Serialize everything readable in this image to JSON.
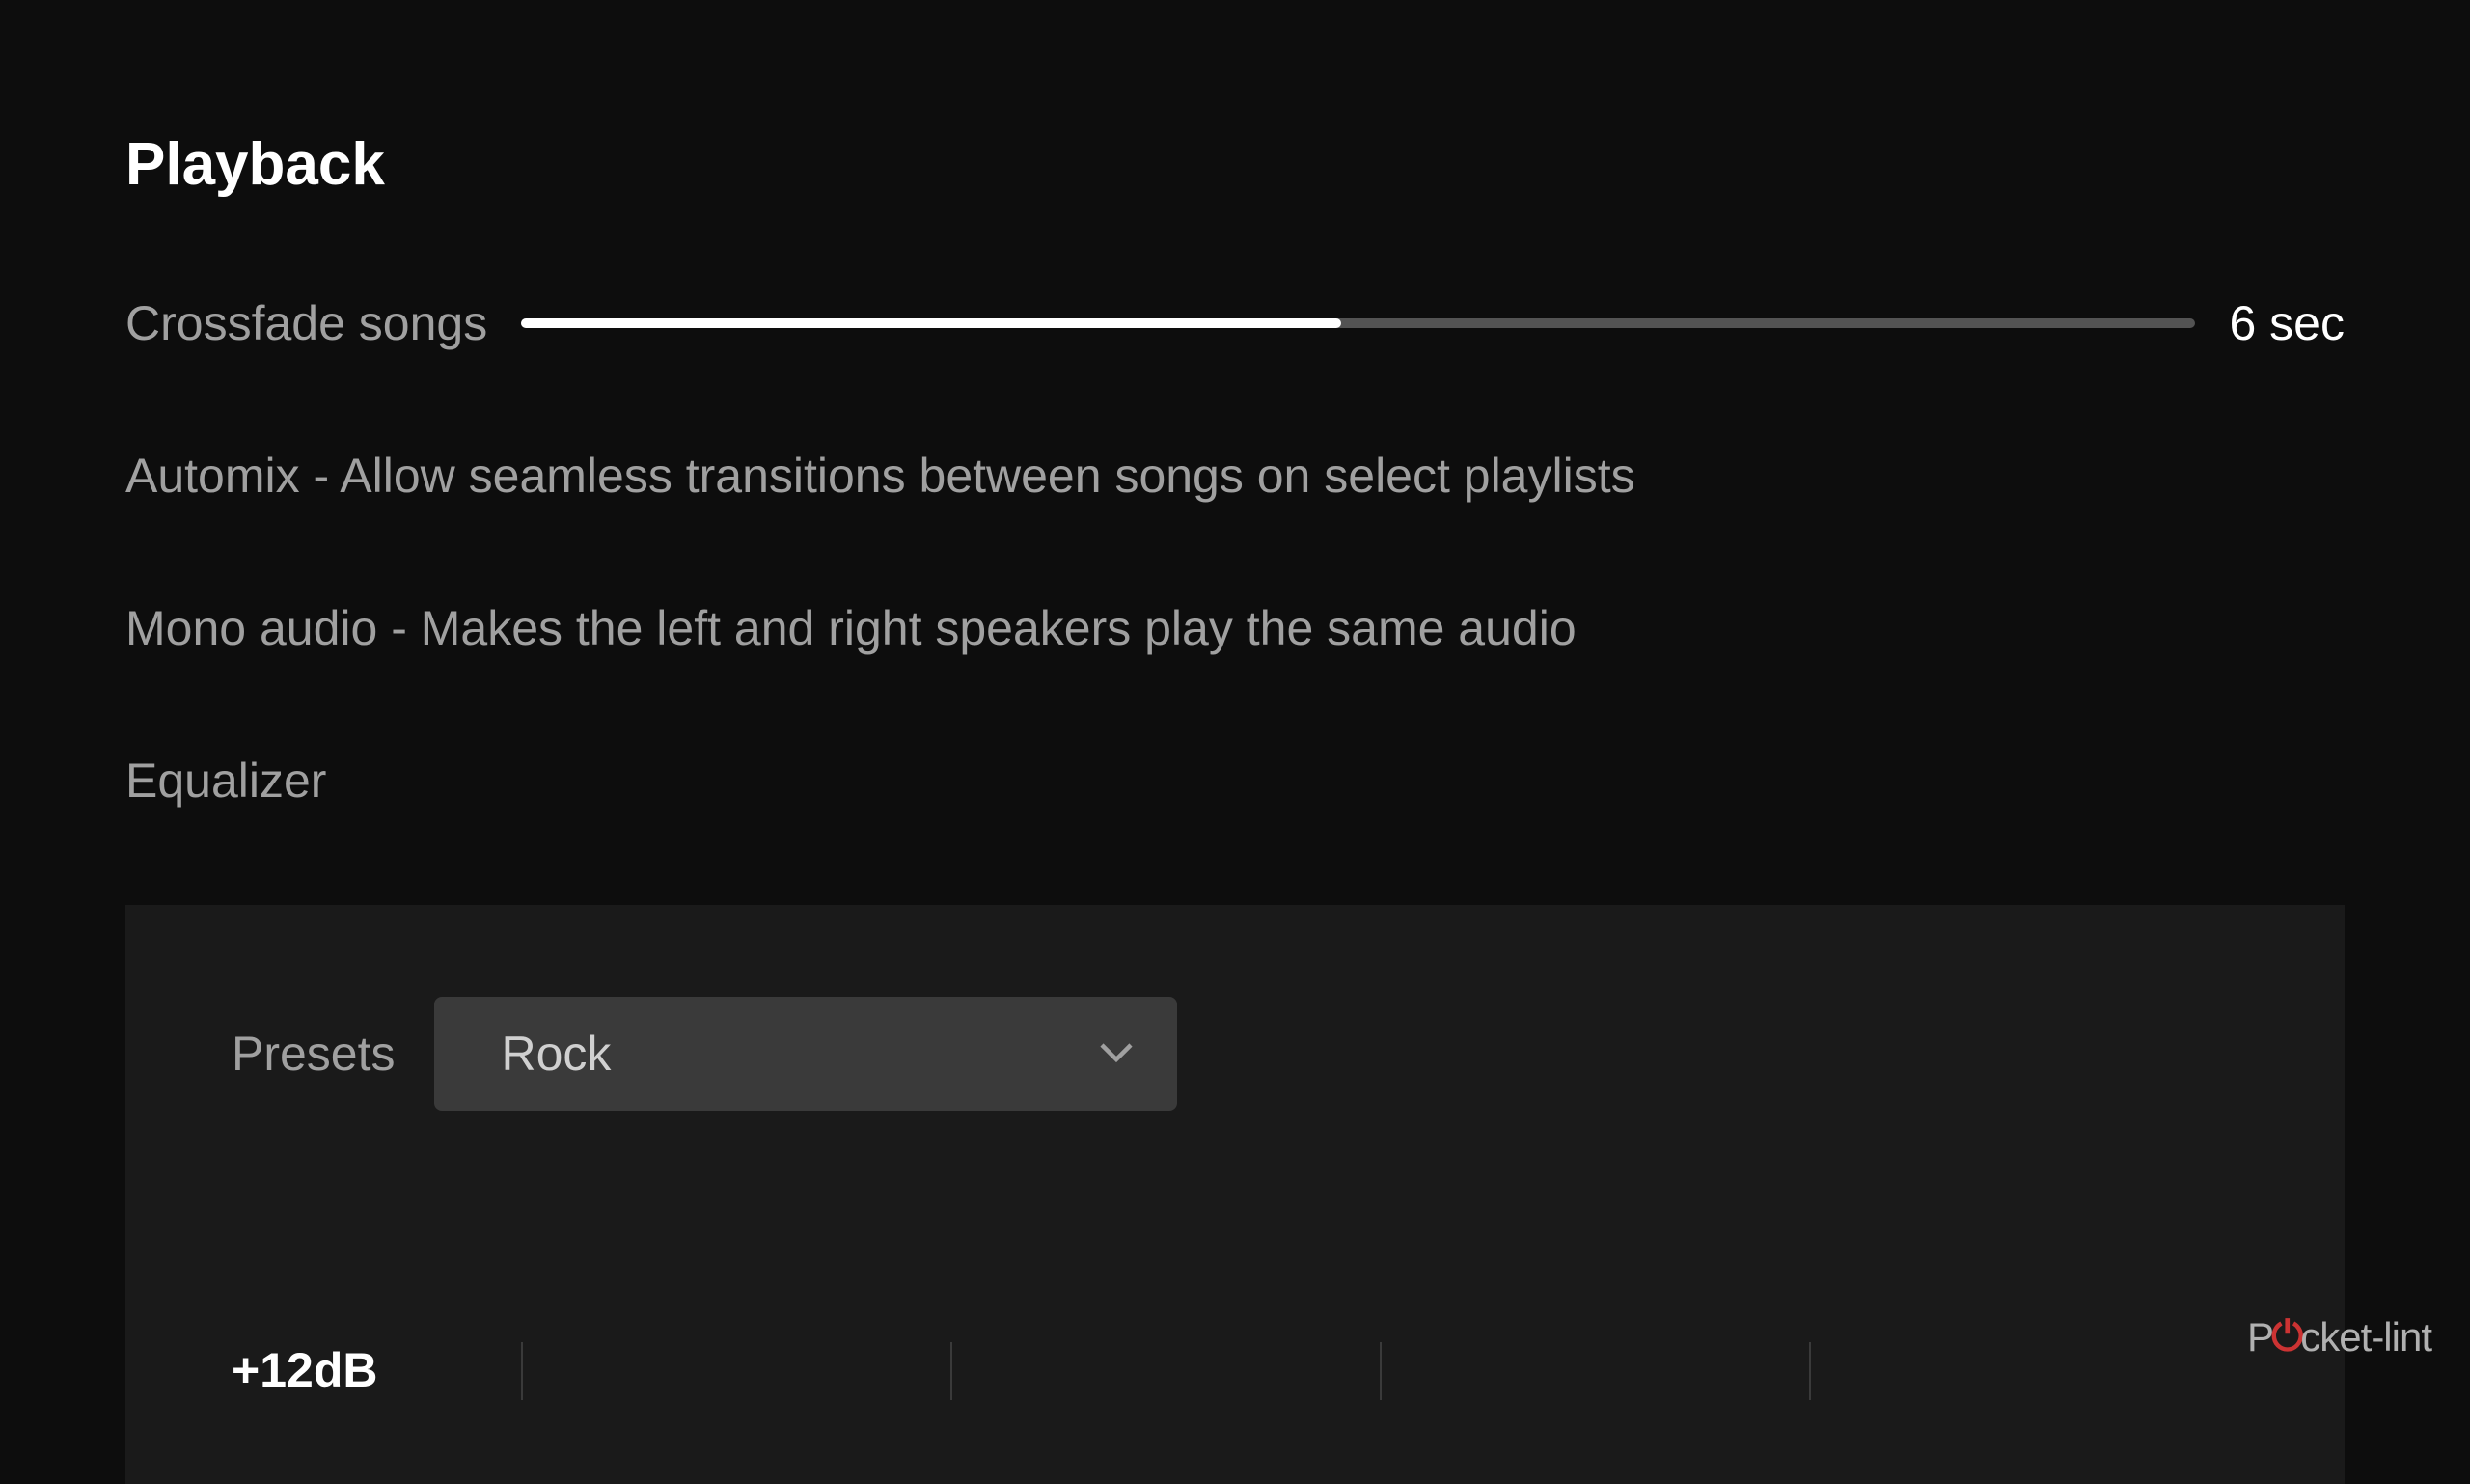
{
  "section": {
    "title": "Playback"
  },
  "crossfade": {
    "label": "Crossfade songs",
    "value": "6 sec",
    "percent": 49
  },
  "automix": {
    "text": "Automix - Allow seamless transitions between songs on select playlists"
  },
  "mono": {
    "text": "Mono audio - Makes the left and right speakers play the same audio"
  },
  "equalizer": {
    "label": "Equalizer",
    "presets_label": "Presets",
    "selected": "Rock",
    "db_label": "+12dB"
  },
  "watermark": {
    "part1": "P",
    "power": "⏻",
    "part2": "cket-lint"
  }
}
